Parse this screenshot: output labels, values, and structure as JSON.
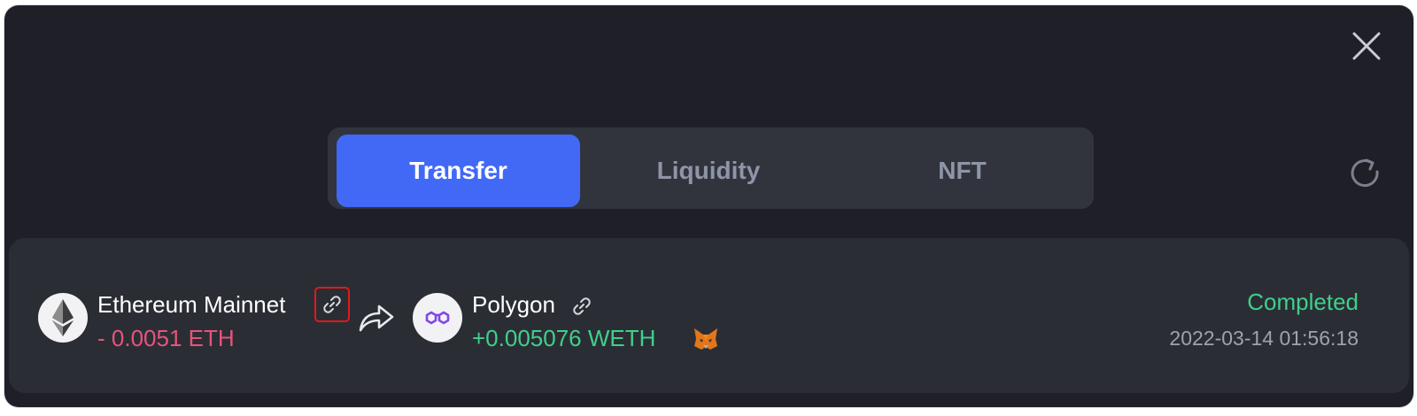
{
  "tabs": [
    {
      "label": "Transfer",
      "active": true
    },
    {
      "label": "Liquidity",
      "active": false
    },
    {
      "label": "NFT",
      "active": false
    }
  ],
  "icons": {
    "close": "close-icon",
    "refresh": "refresh-icon",
    "link": "link-icon",
    "arrow": "share-arrow-icon",
    "wallet": "metamask-fox-icon"
  },
  "transfer": {
    "from_chain": "Ethereum Mainnet",
    "from_amount": "- 0.0051 ETH",
    "to_chain": "Polygon",
    "to_amount": "+0.005076 WETH",
    "status": "Completed",
    "timestamp": "2022-03-14 01:56:18"
  },
  "colors": {
    "background": "#1f2027",
    "row": "#2b2d35",
    "accent": "#4169f5",
    "negative": "#e5547a",
    "positive": "#3fd08a",
    "highlight": "#e01919"
  }
}
